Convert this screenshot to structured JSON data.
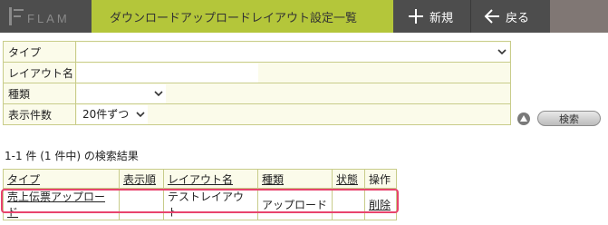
{
  "header": {
    "logo_text": "FLAM",
    "title": "ダウンロードアップロードレイアウト設定一覧",
    "new_label": "新規",
    "back_label": "戻る"
  },
  "form": {
    "type_label": "タイプ",
    "layout_name_label": "レイアウト名",
    "kind_label": "種類",
    "display_count_label": "表示件数",
    "display_count_value": "20件ずつ",
    "search_button": "検索"
  },
  "results": {
    "summary": "1-1 件 (1 件中) の検索結果",
    "columns": [
      "タイプ",
      "表示順",
      "レイアウト名",
      "種類",
      "状態",
      "操作"
    ],
    "rows": [
      {
        "type": "売上伝票アップロード",
        "order": "",
        "layout_name": "テストレイアウト",
        "kind": "アップロード",
        "status": "",
        "action": "削除"
      }
    ]
  },
  "colors": {
    "header_dark": "#4d4d4d",
    "title_green": "#b4c63a",
    "highlight": "#e8446e",
    "form_bg": "#fbfbea"
  }
}
